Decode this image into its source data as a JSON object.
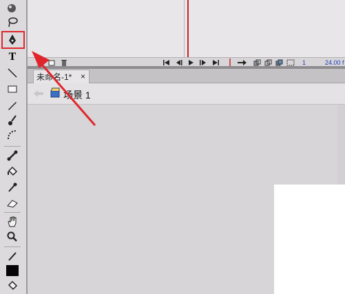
{
  "timeline": {
    "frame_number": "1",
    "frame_rate": "24.00 f"
  },
  "document": {
    "tab_title": "未命名-1*",
    "close_glyph": "×"
  },
  "editbar": {
    "scene_label": "场景 1"
  },
  "tools": {
    "text_tool_glyph": "T"
  },
  "colors": {
    "highlight": "#e0262c",
    "arrow": "#e0262c",
    "playhead": "#c92323"
  },
  "icons": [
    "subselection-icon",
    "lasso-icon",
    "pen-icon",
    "text-icon",
    "line-icon",
    "rectangle-icon",
    "pencil-icon",
    "brush-icon",
    "deco-icon",
    "bone-icon",
    "paint-bucket-icon",
    "eyedropper-icon",
    "eraser-icon",
    "hand-icon",
    "zoom-icon",
    "stroke-color-icon",
    "fill-color-icon",
    "swap-colors-icon"
  ]
}
